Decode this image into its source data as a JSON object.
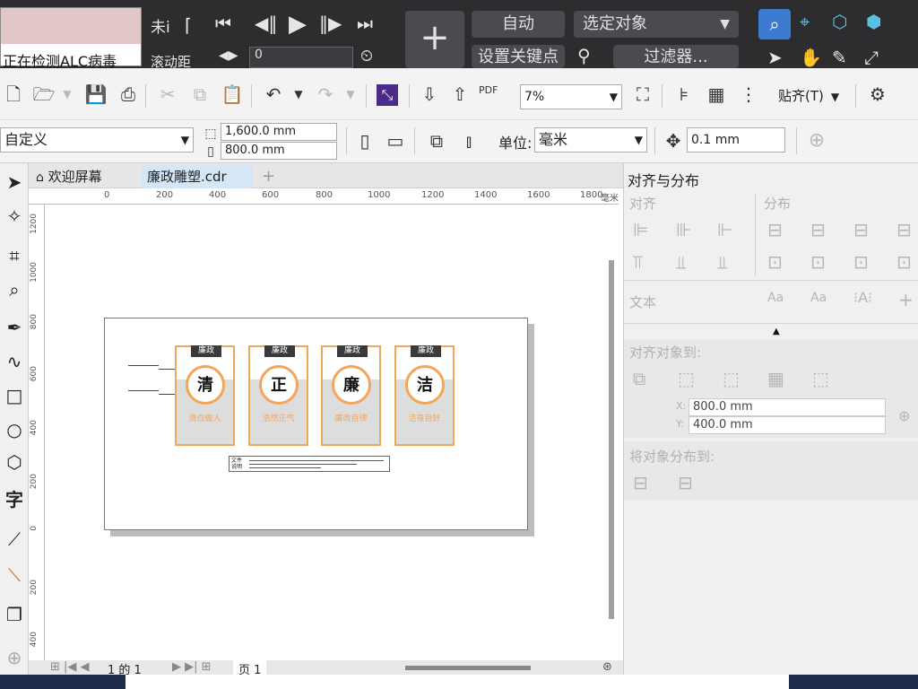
{
  "top": {
    "status_text": "正在检测ALC病毒",
    "label_left": "未i",
    "label_left2": "滚动距",
    "spin_value": "0",
    "auto_btn": "自动",
    "select_target": "选定对象",
    "set_keypoint": "设置关键点",
    "filter_btn": "过滤器..."
  },
  "toolbar": {
    "zoom": "7%",
    "snap_label": "贴齐(T)",
    "pdf_label": "PDF"
  },
  "props": {
    "page_preset": "自定义",
    "width": "1,600.0 mm",
    "height": "800.0 mm",
    "unit_label": "单位:",
    "unit_value": "毫米",
    "nudge": "0.1 mm"
  },
  "tabs": {
    "welcome": "欢迎屏幕",
    "document": "廉政雕塑.cdr"
  },
  "ruler": {
    "top_ticks": [
      "0",
      "200",
      "400",
      "600",
      "800",
      "1000",
      "1200",
      "1400",
      "1600",
      "1800"
    ],
    "top_unit": "毫米",
    "left_ticks": [
      "1200",
      "1000",
      "800",
      "600",
      "400",
      "200",
      "0",
      "200",
      "400"
    ]
  },
  "design": {
    "panels": [
      {
        "tag": "廉政",
        "char": "清",
        "sub": "清白做人"
      },
      {
        "tag": "廉政",
        "char": "正",
        "sub": "浩然正气"
      },
      {
        "tag": "廉政",
        "char": "廉",
        "sub": "廉政自律"
      },
      {
        "tag": "廉政",
        "char": "洁",
        "sub": "洁身自好"
      }
    ],
    "note_label": "文件说明"
  },
  "bottom": {
    "page_of": "1 的 1",
    "page_tab": "页 1"
  },
  "docker": {
    "title": "对齐与分布",
    "align": "对齐",
    "distribute": "分布",
    "text": "文本",
    "align_to": "对齐对象到:",
    "x_label": "X:",
    "x_value": "800.0 mm",
    "y_label": "Y:",
    "y_value": "400.0 mm",
    "distribute_to": "将对象分布到:"
  }
}
